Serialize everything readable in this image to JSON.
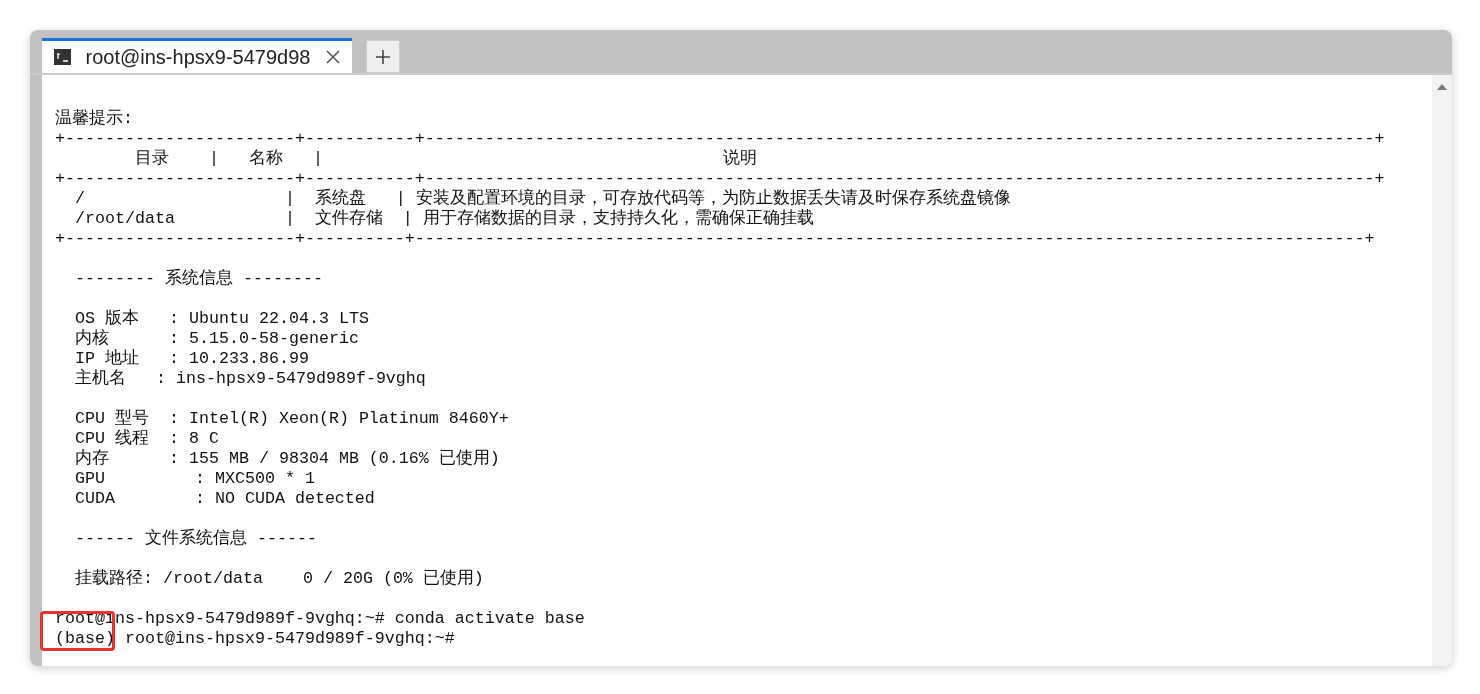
{
  "tabs": [
    {
      "title": "root@ins-hpsx9-5479d98",
      "selected": true
    }
  ],
  "terminal": {
    "blocks": [
      [
        "温馨提示:",
        "+-----------------------+-----------+-----------------------------------------------------------------------------------------------+",
        "        目录    |   名称   |                                        说明",
        "+-----------------------+-----------+-----------------------------------------------------------------------------------------------+",
        "  /                    |  系统盘   | 安装及配置环境的目录，可存放代码等，为防止数据丢失请及时保存系统盘镜像",
        "  /root/data           |  文件存储  | 用于存储数据的目录，支持持久化，需确保正确挂载",
        "+-----------------------+----------+-----------------------------------------------------------------------------------------------+"
      ],
      [
        "  -------- 系统信息 --------"
      ],
      [
        "  OS 版本   : Ubuntu 22.04.3 LTS",
        "  内核      : 5.15.0-58-generic",
        "  IP 地址   : 10.233.86.99",
        "  主机名   : ins-hpsx9-5479d989f-9vghq"
      ],
      [
        "  CPU 型号  : Intel(R) Xeon(R) Platinum 8460Y+",
        "  CPU 线程  : 8 C",
        "  内存      : 155 MB / 98304 MB (0.16% 已使用)",
        "  GPU         : MXC500 * 1",
        "  CUDA        : NO CUDA detected"
      ],
      [
        "  ------ 文件系统信息 ------"
      ],
      [
        "  挂载路径: /root/data    0 / 20G (0% 已使用)"
      ],
      [
        "root@ins-hpsx9-5479d989f-9vghq:~# conda activate base",
        "(base) root@ins-hpsx9-5479d989f-9vghq:~#"
      ]
    ]
  }
}
